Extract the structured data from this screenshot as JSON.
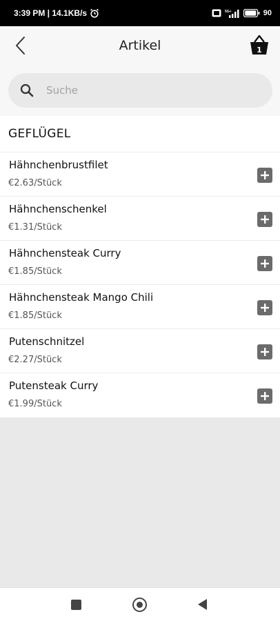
{
  "status": {
    "time_speed": "3:39 PM | 14.1KB/s",
    "alarm_icon": "alarm-icon",
    "network_label": "5G+",
    "battery": "90"
  },
  "header": {
    "title": "Artikel",
    "cart_count": "1"
  },
  "search": {
    "placeholder": "Suche"
  },
  "category": {
    "name": "GEFLÜGEL"
  },
  "items": [
    {
      "name": "Hähnchenbrustfilet",
      "price": "€2.63/Stück"
    },
    {
      "name": "Hähnchenschenkel",
      "price": "€1.31/Stück"
    },
    {
      "name": "Hähnchensteak Curry",
      "price": "€1.85/Stück"
    },
    {
      "name": "Hähnchensteak Mango Chili",
      "price": "€1.85/Stück"
    },
    {
      "name": "Putenschnitzel",
      "price": "€2.27/Stück"
    },
    {
      "name": "Putensteak Curry",
      "price": "€1.99/Stück"
    }
  ],
  "colors": {
    "accent": "#6b6b6b",
    "background": "#e9e9e9"
  }
}
